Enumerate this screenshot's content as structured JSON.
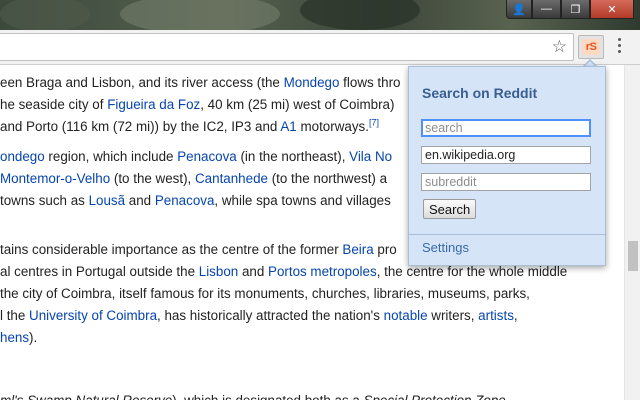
{
  "browser": {
    "window_controls": {
      "user": "👤",
      "minimize": "—",
      "maximize": "❐",
      "close": "✕"
    },
    "bookmark_icon": "☆",
    "extension_label": "rS"
  },
  "article": {
    "lines": [
      [
        {
          "t": "een Braga and Lisbon, and its river access (the "
        },
        {
          "t": "Mondego",
          "link": true
        },
        {
          "t": " flows thro"
        }
      ],
      [
        {
          "t": "he seaside city of "
        },
        {
          "t": "Figueira da Foz",
          "link": true
        },
        {
          "t": ", 40 km (25 mi) west of Coimbra)"
        }
      ],
      [
        {
          "t": "and Porto (116 km (72 mi)) by the IC2, IP3 and "
        },
        {
          "t": "A1",
          "link": true
        },
        {
          "t": " motorways."
        },
        {
          "t": "[7]",
          "link": true,
          "sup": true
        }
      ],
      [],
      [
        {
          "t": "ondego",
          "link": true
        },
        {
          "t": " region, which include "
        },
        {
          "t": "Penacova",
          "link": true
        },
        {
          "t": " (in the northeast), "
        },
        {
          "t": "Vila No",
          "link": true
        }
      ],
      [
        {
          "t": " "
        },
        {
          "t": "Montemor-o-Velho",
          "link": true
        },
        {
          "t": " (to the west), "
        },
        {
          "t": "Cantanhede",
          "link": true
        },
        {
          "t": " (to the northwest) a"
        }
      ],
      [
        {
          "t": " towns such as "
        },
        {
          "t": "Lousã",
          "link": true
        },
        {
          "t": " and "
        },
        {
          "t": "Penacova",
          "link": true
        },
        {
          "t": ", while spa towns and villages"
        }
      ],
      [],
      [
        {
          "t": "tains considerable importance as the centre of the former "
        },
        {
          "t": "Beira",
          "link": true
        },
        {
          "t": " pro"
        }
      ],
      [
        {
          "t": "al centres in Portugal outside the "
        },
        {
          "t": "Lisbon",
          "link": true
        },
        {
          "t": " and "
        },
        {
          "t": "Portos metropoles",
          "link": true
        },
        {
          "t": ", the centre for the whole middle"
        }
      ],
      [
        {
          "t": " the city of Coimbra, itself famous for its monuments, churches, libraries, museums, parks,"
        }
      ],
      [
        {
          "t": "l the "
        },
        {
          "t": "University of Coimbra",
          "link": true
        },
        {
          "t": ", has historically attracted the nation's "
        },
        {
          "t": "notable",
          "link": true
        },
        {
          "t": " writers, "
        },
        {
          "t": "artists",
          "link": true
        },
        {
          "t": ","
        }
      ],
      [
        {
          "t": "hens",
          "link": true
        },
        {
          "t": ")."
        }
      ],
      [],
      [],
      [
        {
          "t": "ml's Swamp Natural Reserve",
          "em": true
        },
        {
          "t": "), which is designated both as a "
        },
        {
          "t": "Special Protection Zone",
          "em": true
        }
      ]
    ]
  },
  "popup": {
    "title": "Search on Reddit",
    "search_placeholder": "search",
    "search_value": "",
    "site_value": "en.wikipedia.org",
    "subreddit_placeholder": "subreddit",
    "subreddit_value": "",
    "search_button": "Search",
    "settings_link": "Settings"
  }
}
